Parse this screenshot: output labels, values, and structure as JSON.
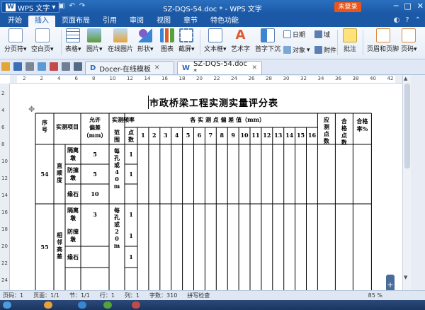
{
  "titlebar": {
    "app_menu": "WPS 文字",
    "app_menu_badge": "W",
    "window_title": "SZ-DQS-54.doc * - WPS 文字",
    "login": "未登录",
    "qat_icons": [
      "save-icon",
      "undo-icon",
      "redo-icon"
    ]
  },
  "menubar": {
    "tabs": [
      "开始",
      "插入",
      "页面布局",
      "引用",
      "审阅",
      "视图",
      "章节",
      "特色功能"
    ],
    "active": "插入"
  },
  "ribbon": {
    "pagebreak": "分页符",
    "blankpage": "空白页",
    "table": "表格",
    "picture": "图片",
    "online_picture": "在线图片",
    "shape": "形状",
    "chart": "图表",
    "screenshot": "截屏",
    "textbox": "文本框",
    "wordart": "艺术字",
    "dropcap": "首字下沉",
    "date": "日期",
    "field": "域",
    "object": "对象",
    "attachment": "附件",
    "comment": "批注",
    "header_footer": "页眉和页脚",
    "page_number": "页码"
  },
  "doctabs": [
    {
      "label": "Docer-在线模板"
    },
    {
      "label": "SZ-DQS-54.doc *"
    }
  ],
  "ruler": {
    "h_ticks": [
      "2",
      "2",
      "4",
      "6",
      "8",
      "10",
      "12",
      "14",
      "16",
      "18",
      "20",
      "22",
      "24",
      "26",
      "28",
      "30",
      "32",
      "34",
      "36",
      "38",
      "40",
      "42"
    ],
    "v_ticks": [
      "2",
      "4",
      "6",
      "8",
      "10",
      "12",
      "14",
      "16",
      "18",
      "20",
      "22",
      "24"
    ]
  },
  "document": {
    "title": "市政桥梁工程实测实量评分表",
    "headers": {
      "seq": "序号",
      "item": "实测项目",
      "allowance": "允许偏差（mm）",
      "freq": "实测频率",
      "range": "范围",
      "points": "点数",
      "measured": "各 实 测 点 偏 差 值（mm）",
      "should": "应测点数",
      "pass": "合格点数",
      "rate": "合格率%"
    },
    "col_numbers": [
      "1",
      "2",
      "3",
      "4",
      "5",
      "6",
      "7",
      "8",
      "9",
      "10",
      "11",
      "12",
      "13",
      "14",
      "15",
      "16"
    ],
    "rows": [
      {
        "seq": "54",
        "item": "直顺度",
        "freq_range": "每孔或40m",
        "sub": [
          {
            "name": "隔离墩",
            "allowance": "5",
            "points": "1"
          },
          {
            "name": "防撞墩",
            "allowance": "5",
            "points": "1"
          },
          {
            "name": "缘石",
            "allowance": "10",
            "points": ""
          }
        ]
      },
      {
        "seq": "55",
        "item": "相邻高差",
        "freq_range": "每孔或20m",
        "sub": [
          {
            "name": "隔离墩",
            "allowance": "3",
            "points": "1"
          },
          {
            "name": "防撞墩",
            "allowance": "",
            "points": "1"
          },
          {
            "name": "缘石",
            "allowance": "",
            "points": "1"
          }
        ]
      }
    ]
  },
  "statusbar": {
    "page": "页码：1",
    "pages": "页面：1/1",
    "section": "节：1/1",
    "row": "行：1",
    "column": "列：1",
    "words": "字数：310",
    "spell": "拼写检查",
    "zoom": "85 %"
  }
}
